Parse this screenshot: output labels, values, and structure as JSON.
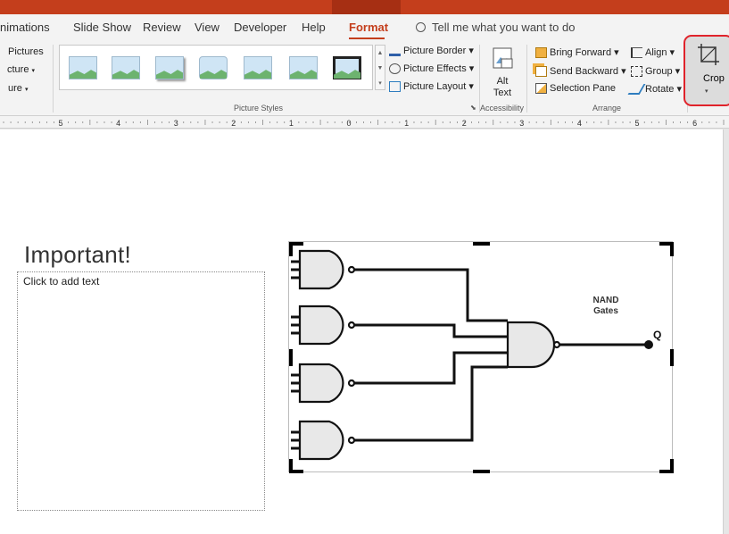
{
  "tabs": {
    "items": [
      "nimations",
      "Slide Show",
      "Review",
      "View",
      "Developer",
      "Help"
    ],
    "active": "Format",
    "tellme": "Tell me what you want to do"
  },
  "ribbon": {
    "left_items": [
      "Pictures",
      "cture",
      "ure"
    ],
    "picture_styles": {
      "label": "Picture Styles",
      "border": "Picture Border",
      "effects": "Picture Effects",
      "layout": "Picture Layout"
    },
    "accessibility": {
      "label": "Accessibility",
      "alt_text_line1": "Alt",
      "alt_text_line2": "Text"
    },
    "arrange": {
      "label": "Arrange",
      "bring_forward": "Bring Forward",
      "send_backward": "Send Backward",
      "selection_pane": "Selection Pane",
      "align": "Align",
      "group": "Group",
      "rotate": "Rotate"
    },
    "crop": "Crop"
  },
  "ruler": {
    "labels": [
      "5",
      "4",
      "3",
      "2",
      "1",
      "0",
      "1",
      "2",
      "3",
      "4",
      "5",
      "6"
    ]
  },
  "slide": {
    "title": "Important!",
    "content_placeholder": "Click to add text",
    "picture": {
      "label_line1": "NAND",
      "label_line2": "Gates",
      "output_label": "Q"
    }
  },
  "colors": {
    "accent": "#c43e1c",
    "crop_highlight": "#e0232b"
  }
}
